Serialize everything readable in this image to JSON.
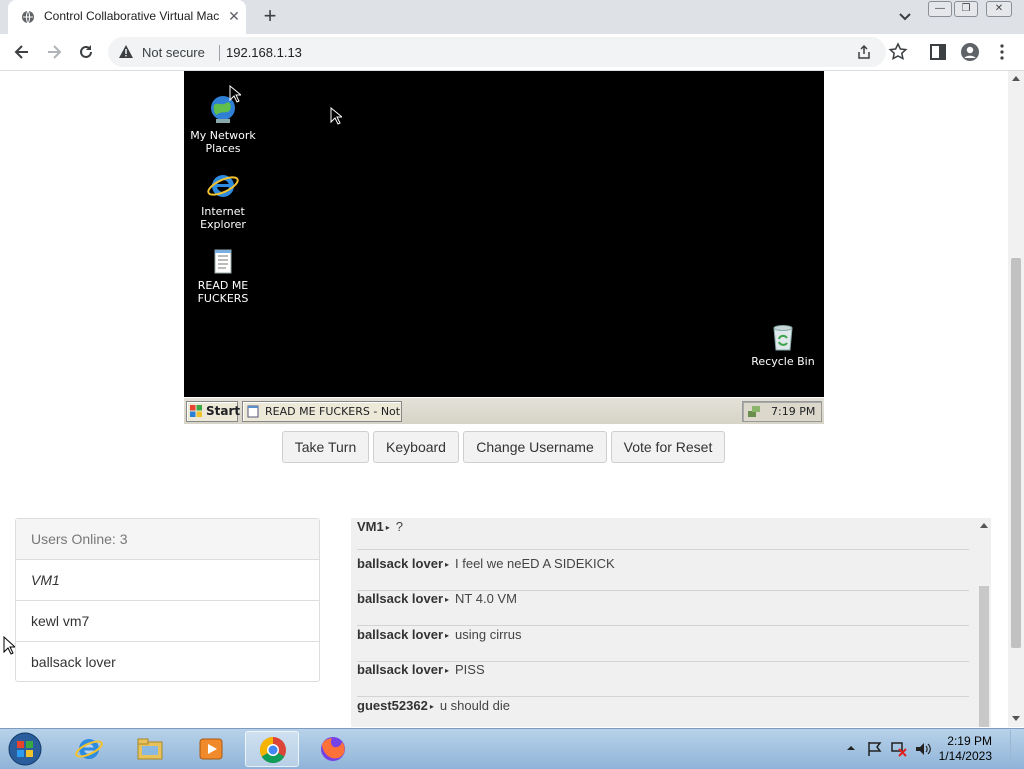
{
  "browser": {
    "tab_title": "Control Collaborative Virtual Machine",
    "address_security": "Not secure",
    "address_url": "192.168.1.13"
  },
  "vm": {
    "desktop_icons": [
      {
        "label_line1": "My Network",
        "label_line2": "Places",
        "icon": "network-places-icon"
      },
      {
        "label_line1": "Internet",
        "label_line2": "Explorer",
        "icon": "internet-explorer-icon"
      },
      {
        "label_line1": "READ ME",
        "label_line2": "FUCKERS",
        "icon": "notepad-file-icon"
      },
      {
        "label_line1": "Recycle Bin",
        "label_line2": "",
        "icon": "recycle-bin-icon"
      }
    ],
    "taskbar": {
      "start_label": "Start",
      "task_label": "READ ME FUCKERS - Not...",
      "clock": "7:19 PM"
    }
  },
  "controls": {
    "take_turn": "Take Turn",
    "keyboard": "Keyboard",
    "change_username": "Change Username",
    "vote_reset": "Vote for Reset"
  },
  "users": {
    "header": "Users Online: 3",
    "list": [
      "VM1",
      "kewl vm7",
      "ballsack lover"
    ]
  },
  "chat": {
    "messages": [
      {
        "user": "VM1",
        "text": "?"
      },
      {
        "user": "ballsack lover",
        "text": "I feel we neED A SIDEKICK"
      },
      {
        "user": "ballsack lover",
        "text": "NT 4.0 VM"
      },
      {
        "user": "ballsack lover",
        "text": "using cirrus"
      },
      {
        "user": "ballsack lover",
        "text": "PISS"
      },
      {
        "user": "guest52362",
        "text": "u should die"
      }
    ]
  },
  "windows_taskbar": {
    "time": "2:19 PM",
    "date": "1/14/2023",
    "pinned": [
      "start-orb",
      "internet-explorer",
      "file-explorer",
      "media-player",
      "chrome",
      "firefox"
    ]
  },
  "colors": {
    "tabstrip": "#dee1e6",
    "vm_background": "#000000",
    "win7_taskbar": "#a9c6e3"
  }
}
